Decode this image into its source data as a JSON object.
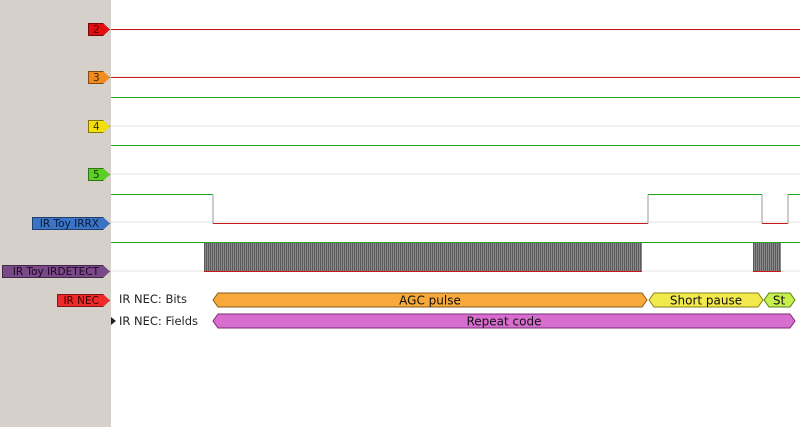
{
  "channels": [
    {
      "label": "2",
      "color": "#e01010"
    },
    {
      "label": "3",
      "color": "#f08c1e"
    },
    {
      "label": "4",
      "color": "#f3de10"
    },
    {
      "label": "5",
      "color": "#5ccf25"
    },
    {
      "label": "IR Toy IRRX",
      "color": "#3b74c4"
    },
    {
      "label": "IR Toy IRDETECT",
      "color": "#7a4a88"
    },
    {
      "label": "IR NEC",
      "color": "#ef2a2a"
    }
  ],
  "decoder": {
    "rows": [
      {
        "label": "IR NEC: Bits"
      },
      {
        "label": "IR NEC: Fields"
      }
    ],
    "bits": [
      {
        "text": "AGC pulse",
        "color": "#f7a93b"
      },
      {
        "text": "Short pause",
        "color": "#f2ea4c"
      },
      {
        "text": "St",
        "color": "#c8ef4e"
      }
    ],
    "fields": [
      {
        "text": "Repeat code",
        "color": "#d86dd0"
      }
    ]
  },
  "colors": {
    "signal_high": "#1ea51e",
    "signal_low": "#c81818",
    "sidebar_bg": "#d5d0ca",
    "grid": "#e3e3e3"
  }
}
